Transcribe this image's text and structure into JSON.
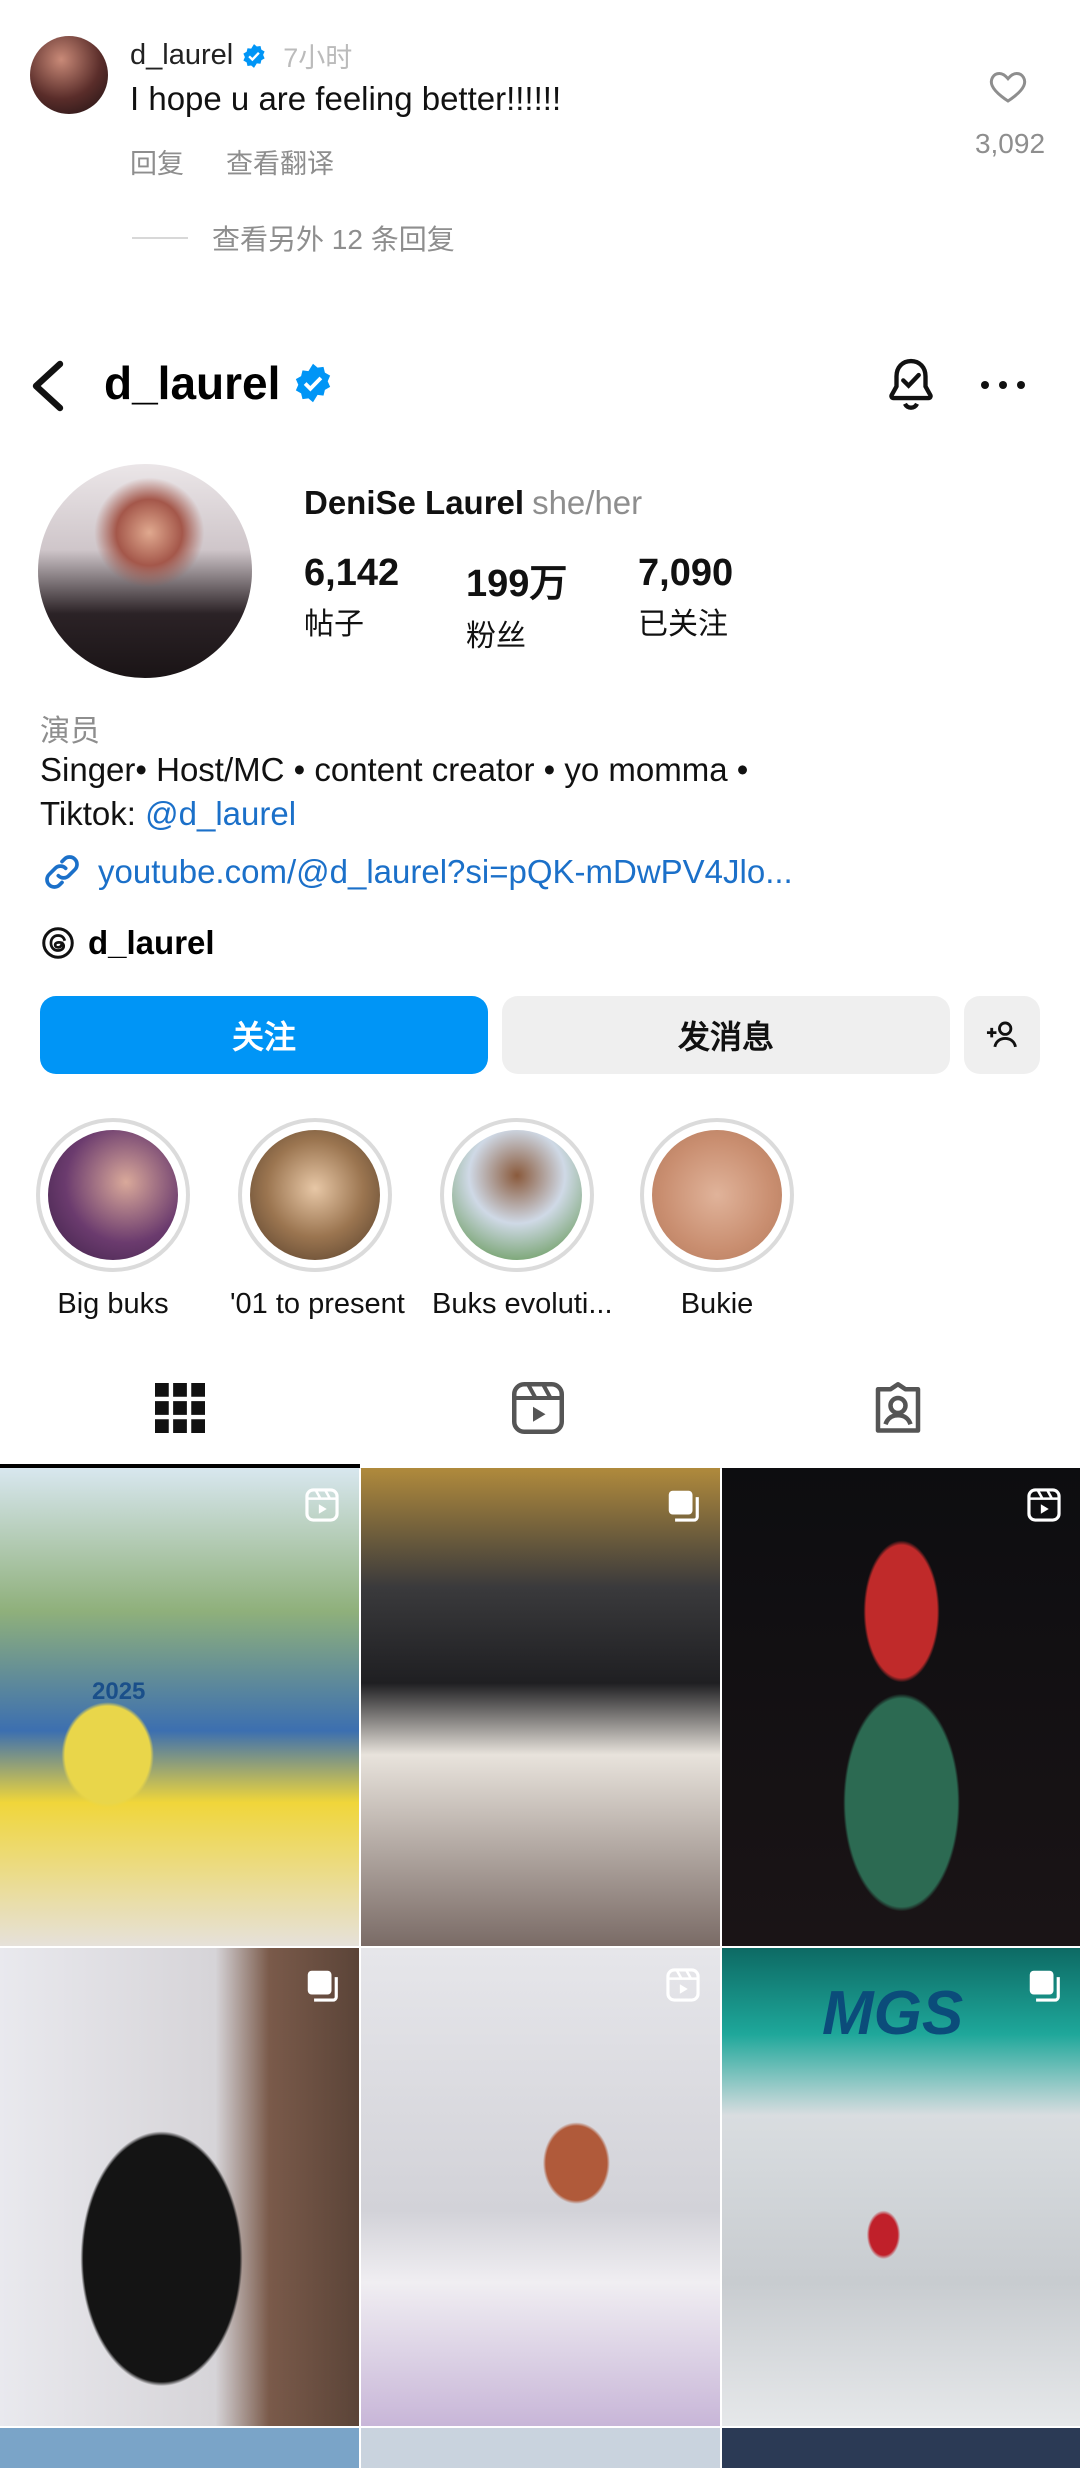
{
  "comment": {
    "username": "d_laurel",
    "time": "7小时",
    "text": "I hope u are feeling better!!!!!!",
    "reply_label": "回复",
    "translate_label": "查看翻译",
    "like_count": "3,092",
    "view_more_replies": "查看另外 12 条回复"
  },
  "profile": {
    "username": "d_laurel",
    "display_name": "DeniSe Laurel",
    "pronouns": "she/her",
    "stats": [
      {
        "value": "6,142",
        "label": "帖子"
      },
      {
        "value": "199万",
        "label": "粉丝"
      },
      {
        "value": "7,090",
        "label": "已关注"
      }
    ],
    "category": "演员",
    "bio_line1": "Singer• Host/MC • content creator • yo momma •",
    "bio_line2_prefix": "Tiktok: ",
    "bio_line2_handle": "@d_laurel",
    "link": "youtube.com/@d_laurel?si=pQK-mDwPV4Jlo...",
    "threads_handle": "d_laurel",
    "follow_label": "关注",
    "message_label": "发消息"
  },
  "highlights": [
    {
      "label": "Big buks"
    },
    {
      "label": "'01 to present"
    },
    {
      "label": "Buks evoluti..."
    },
    {
      "label": "Bukie"
    }
  ],
  "grid_tiles": [
    {
      "type": "reel",
      "overlay": "2025"
    },
    {
      "type": "carousel"
    },
    {
      "type": "reel"
    },
    {
      "type": "carousel"
    },
    {
      "type": "reel"
    },
    {
      "type": "carousel",
      "overlay": "MGS"
    }
  ],
  "colors": {
    "accent": "#0095f6",
    "link": "#1b70c9",
    "muted": "#8e8e8e",
    "verified": "#0095f6"
  }
}
